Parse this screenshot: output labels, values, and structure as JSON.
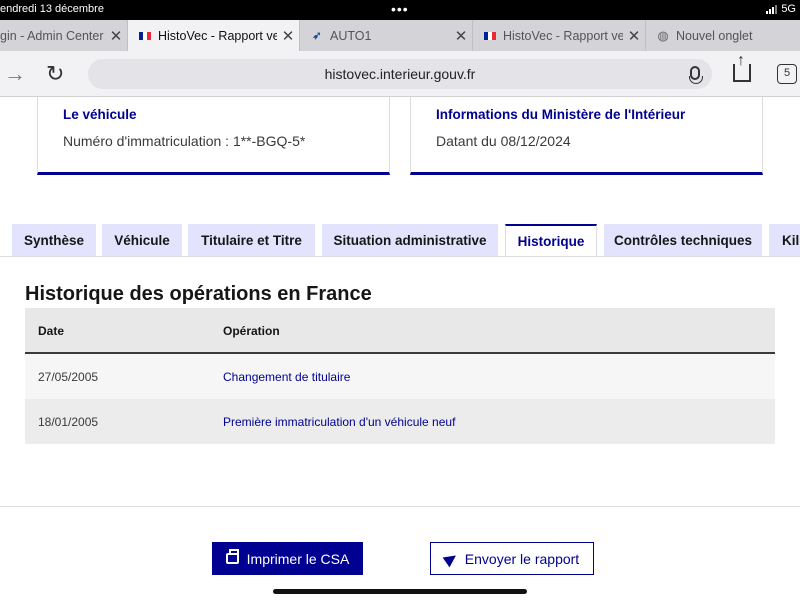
{
  "status_bar": {
    "time": "endredi 13 décembre",
    "network": "5G"
  },
  "browser_tabs": [
    {
      "title": "gin - Admin Center",
      "icon": "none"
    },
    {
      "title": "HistoVec - Rapport ve",
      "icon": "french-flag-icon",
      "active": true
    },
    {
      "title": "AUTO1",
      "icon": "auto1-logo-icon"
    },
    {
      "title": "HistoVec - Rapport ve",
      "icon": "french-flag-icon"
    },
    {
      "title": "Nouvel onglet",
      "icon": "globe-icon"
    }
  ],
  "address_bar": {
    "url": "histovec.interieur.gouv.fr",
    "tab_count": "5"
  },
  "cards": [
    {
      "title": "Le véhicule",
      "value": "Numéro d'immatriculation : 1**-BGQ-5*"
    },
    {
      "title": "Informations du Ministère de l'Intérieur",
      "value": "Datant du 08/12/2024"
    }
  ],
  "page_tabs": [
    {
      "label": "Synthèse"
    },
    {
      "label": "Véhicule"
    },
    {
      "label": "Titulaire et Titre"
    },
    {
      "label": "Situation administrative"
    },
    {
      "label": "Historique",
      "active": true
    },
    {
      "label": "Contrôles techniques"
    },
    {
      "label": "Kil"
    }
  ],
  "history": {
    "heading": "Historique des opérations en France",
    "columns": [
      "Date",
      "Opération"
    ],
    "rows": [
      {
        "date": "27/05/2005",
        "operation": "Changement de titulaire"
      },
      {
        "date": "18/01/2005",
        "operation": "Première immatriculation d'un véhicule neuf"
      }
    ]
  },
  "actions": {
    "print_label": "Imprimer le CSA",
    "send_label": "Envoyer le rapport"
  },
  "colors": {
    "primary": "#000091",
    "tab_inactive": "#e3e3fd"
  }
}
